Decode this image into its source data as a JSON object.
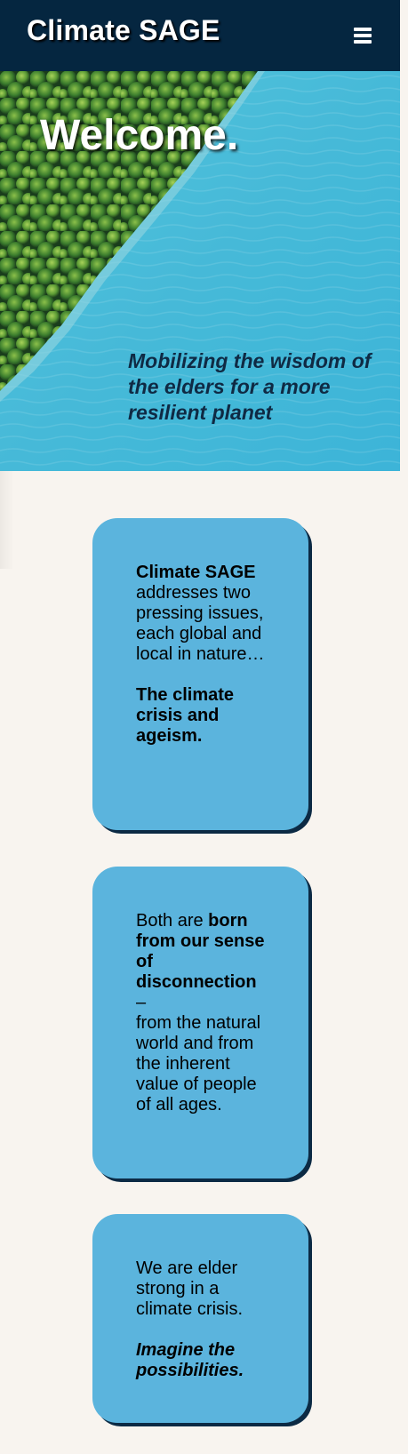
{
  "header": {
    "brand": "Climate SAGE",
    "menu_icon": "hamburger-menu-icon"
  },
  "hero": {
    "title": "Welcome.",
    "tagline": "Mobilizing the wisdom of the elders for a more resilient planet",
    "image_description_colors": {
      "forest": "#2f6b2a",
      "water": "#3bbbd9"
    }
  },
  "cards": [
    {
      "lead_bold": "Climate SAGE",
      "lead_text": "addresses two pressing issues, each global and local in nature…",
      "emphasis": "The climate crisis and ageism."
    },
    {
      "prefix": "Both are",
      "bold": "born from our sense of disconnection",
      "dash": "–",
      "text": "from the natural world and from the inherent value of people of all ages."
    },
    {
      "text": "We are elder strong in a climate crisis.",
      "emphasis": "Imagine the possibilities."
    }
  ],
  "colors": {
    "header_bg": "#052640",
    "page_bg": "#f8f4ef",
    "card_bg": "#5bb4dd",
    "card_shadow": "#0c2a44",
    "tagline": "#0f2a44"
  }
}
